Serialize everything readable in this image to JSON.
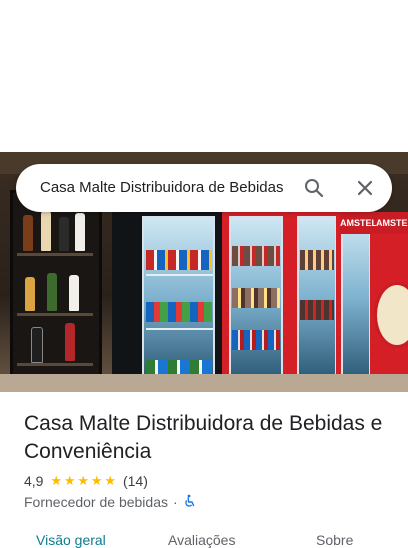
{
  "search": {
    "query": "Casa Malte Distribuidora de Bebidas"
  },
  "place": {
    "name": "Casa Malte Distribuidora de Bebidas e Conveniência",
    "rating": "4,9",
    "review_count": "(14)",
    "stars": 5,
    "category": "Fornecedor de bebidas",
    "separator": "·",
    "accessibility_icon": "wheelchair-icon"
  },
  "photo": {
    "fridge_brand": "AMSTEL"
  },
  "tabs": [
    {
      "label": "Visão geral",
      "active": true
    },
    {
      "label": "Avaliações",
      "active": false
    },
    {
      "label": "Sobre",
      "active": false
    }
  ],
  "colors": {
    "accent": "#0b7c8f",
    "star": "#fbbc04",
    "accessibility": "#1a73e8"
  }
}
